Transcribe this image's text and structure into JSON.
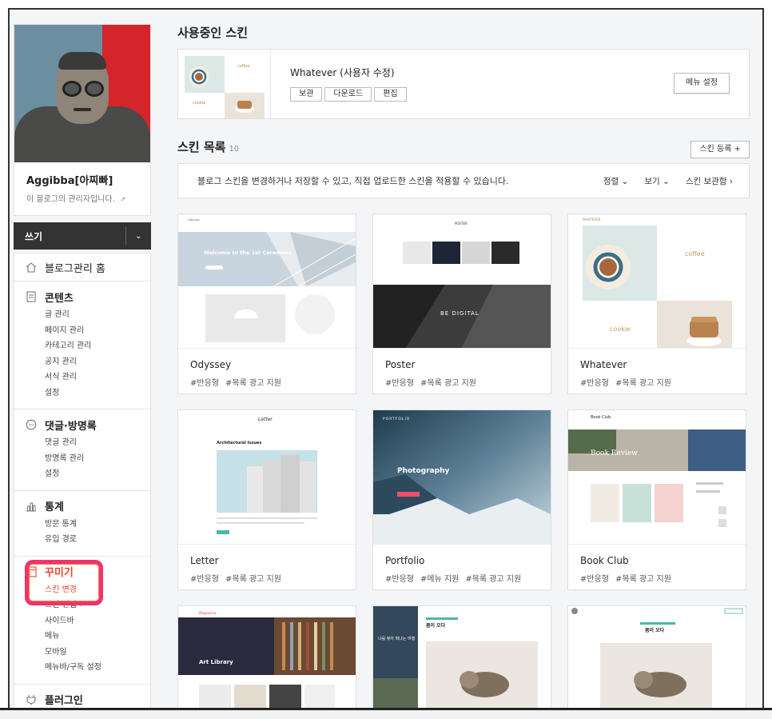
{
  "profile": {
    "name": "Aggibba[아찌빠]",
    "subtitle": "이 블로그의 관리자입니다."
  },
  "write": {
    "label": "쓰기"
  },
  "menu": {
    "home": "블로그관리 홈",
    "contents": {
      "title": "콘텐츠",
      "items": [
        "글 관리",
        "페이지 관리",
        "카테고리 관리",
        "공지 관리",
        "서식 관리",
        "설정"
      ]
    },
    "comments": {
      "title": "댓글·방명록",
      "items": [
        "댓글 관리",
        "방명록 관리",
        "설정"
      ]
    },
    "stats": {
      "title": "통계",
      "items": [
        "방문 통계",
        "유입 경로"
      ]
    },
    "decorate": {
      "title": "꾸미기",
      "items": [
        "스킨 변경",
        "스킨 편집",
        "사이드바",
        "메뉴",
        "모바일",
        "메뉴바/구독 설정"
      ]
    },
    "plugin": "플러그인"
  },
  "current_skin": {
    "section_title": "사용중인 스킨",
    "name": "Whatever (사용자 수정)",
    "buttons": [
      "보관",
      "다운로드",
      "편집"
    ],
    "menu_settings": "메뉴 설정"
  },
  "skin_list": {
    "title": "스킨 목록",
    "count": "10",
    "register": "스킨 등록 +",
    "description": "블로그 스킨을 변경하거나 저장할 수 있고, 직접 업로드한 스킨을 적용할 수 있습니다.",
    "sort": "정렬",
    "view": "보기",
    "storage": "스킨 보관함",
    "cards": [
      {
        "name": "Odyssey",
        "tags": [
          "#반응형",
          "#목록 광고 지원"
        ]
      },
      {
        "name": "Poster",
        "tags": [
          "#반응형",
          "#목록 광고 지원"
        ]
      },
      {
        "name": "Whatever",
        "tags": [
          "#반응형",
          "#목록 광고 지원"
        ]
      },
      {
        "name": "Letter",
        "tags": [
          "#반응형",
          "#목록 광고 지원"
        ]
      },
      {
        "name": "Portfolio",
        "tags": [
          "#반응형",
          "#메뉴 지원",
          "#목록 광고 지원"
        ]
      },
      {
        "name": "Book Club",
        "tags": [
          "#반응형",
          "#목록 광고 지원"
        ]
      }
    ],
    "thumb_text": {
      "odyssey_hero": "Welcome to the 1st Ceremony",
      "poster_head": "POSTER",
      "poster_hero": "BE DIGITAL",
      "whatever_head": "WHATEVER",
      "whatever_coffee": "coffee",
      "whatever_cookie": "cookie",
      "letter_head": "Letter",
      "letter_title": "Architectural Issues",
      "portfolio_head": "PORTFOLIO",
      "portfolio_hero": "Photography",
      "bookclub_head": "Book Club",
      "bookclub_hero": "Book Review",
      "magazine_head": "Magazine",
      "magazine_hero": "Art Library",
      "cat2_title": "봄이 오다",
      "cat2_side": "나를 찾아 떠나는 여행",
      "cat3_title": "봄이 오다"
    }
  },
  "colors": {
    "accent": "#e8462d",
    "highlight": "#f0336b",
    "dark_bar": "#333333"
  }
}
